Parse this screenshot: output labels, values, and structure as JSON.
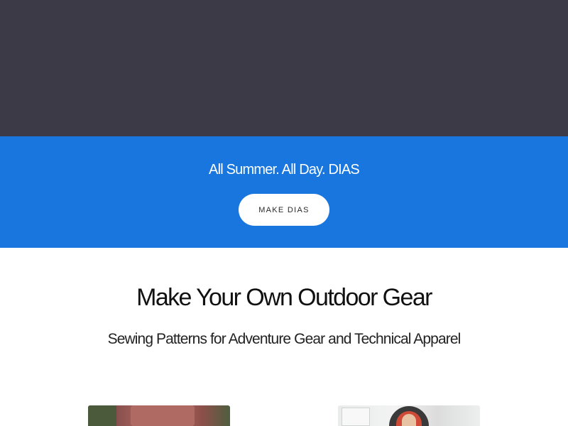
{
  "hero": {
    "background_color": "#3d3a47"
  },
  "promo": {
    "background_color": "#1976de",
    "text": "All Summer. All Day. DIAS",
    "button_label": "MAKE DIAS"
  },
  "intro": {
    "heading": "Make Your Own Outdoor Gear",
    "subheading": "Sewing Patterns for Adventure Gear and Technical Apparel"
  },
  "cards": [
    {
      "image_semantic": "person-in-red-shirt-photo"
    },
    {
      "image_semantic": "person-in-red-hood-photo"
    }
  ]
}
